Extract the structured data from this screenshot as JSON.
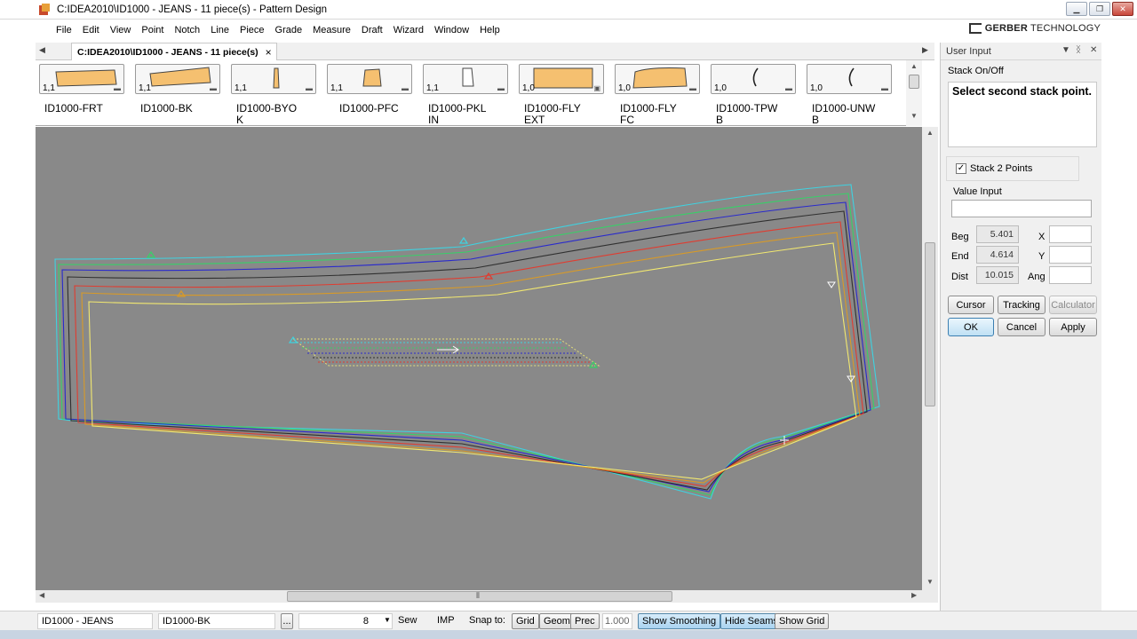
{
  "window": {
    "title": "C:IDEA2010\\ID1000 - JEANS  -  11 piece(s)  - Pattern Design",
    "controls": [
      "minimize-icon",
      "maximize-icon",
      "close-icon"
    ]
  },
  "menu": [
    "File",
    "Edit",
    "View",
    "Point",
    "Notch",
    "Line",
    "Piece",
    "Grade",
    "Measure",
    "Draft",
    "Wizard",
    "Window",
    "Help"
  ],
  "brand": {
    "name": "GERBER",
    "suffix": "TECHNOLOGY"
  },
  "doc_tab": {
    "label": "C:IDEA2010\\ID1000 - JEANS  -  11 piece(s)",
    "close": "×"
  },
  "pieces": [
    {
      "count": "1,1",
      "label": "ID1000-FRT"
    },
    {
      "count": "1,1",
      "label": "ID1000-BK"
    },
    {
      "count": "1,1",
      "label": "ID1000-BYO\nK"
    },
    {
      "count": "1,1",
      "label": "ID1000-PFC"
    },
    {
      "count": "1,1",
      "label": "ID1000-PKL\nIN"
    },
    {
      "count": "1,0",
      "label": "ID1000-FLY\nEXT"
    },
    {
      "count": "1,0",
      "label": "ID1000-FLY\nFC"
    },
    {
      "count": "1,0",
      "label": "ID1000-TPW\nB"
    },
    {
      "count": "1,0",
      "label": "ID1000-UNW\nB"
    }
  ],
  "panel": {
    "title": "User Input",
    "mode": "Stack On/Off",
    "prompt": "Select second stack point.",
    "stack_label": "Stack 2 Points",
    "stack_checked": true,
    "value_input_label": "Value Input",
    "beg_label": "Beg",
    "beg_value": "5.401",
    "end_label": "End",
    "end_value": "4.614",
    "dist_label": "Dist",
    "dist_value": "10.015",
    "x_label": "X",
    "y_label": "Y",
    "ang_label": "Ang",
    "buttons": {
      "cursor": "Cursor",
      "tracking": "Tracking",
      "calculator": "Calculator",
      "ok": "OK",
      "cancel": "Cancel",
      "apply": "Apply"
    }
  },
  "status": {
    "style_name": "ID1000 - JEANS",
    "piece_name": "ID1000-BK",
    "ellipsis": "...",
    "number": "8",
    "sew": "Sew",
    "units": "IMP",
    "snap_label": "Snap to:",
    "grid": "Grid",
    "geom": "Geom",
    "prec": "Prec",
    "prec_value": "1.000",
    "show_smoothing": "Show Smoothing",
    "hide_seams": "Hide Seams",
    "show_grid": "Show Grid"
  }
}
